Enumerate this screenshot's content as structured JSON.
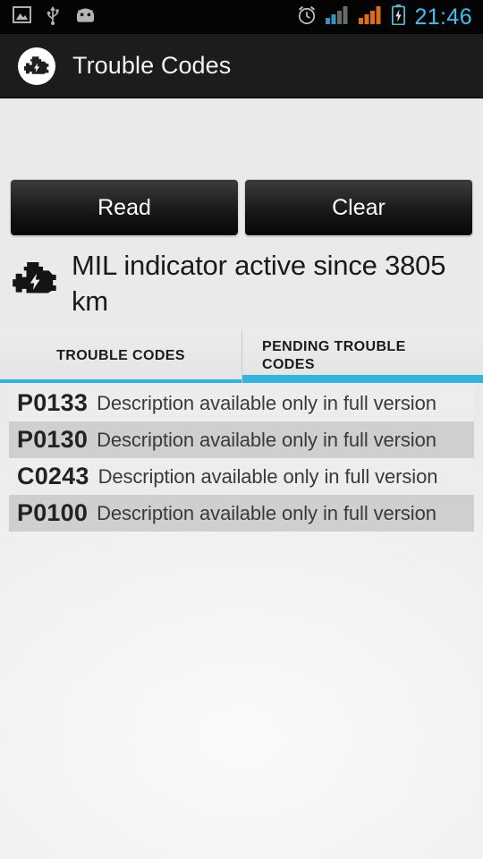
{
  "status_bar": {
    "left_icons": [
      {
        "name": "gallery-image-icon",
        "glyph": "image"
      },
      {
        "name": "usb-icon",
        "glyph": "usb"
      },
      {
        "name": "android-robot-icon",
        "glyph": "android"
      }
    ],
    "right_icons": [
      {
        "name": "alarm-clock-icon",
        "glyph": "alarm"
      },
      {
        "name": "signal-bars-sim1-icon",
        "glyph": "signal",
        "color": "#3a9fd0"
      },
      {
        "name": "signal-bars-sim2-icon",
        "glyph": "signal",
        "color": "#f07818"
      },
      {
        "name": "battery-charging-icon",
        "glyph": "battery",
        "color": "#5fc5e8"
      }
    ],
    "clock": "21:46"
  },
  "action_bar": {
    "logo_icon": "check-engine-icon",
    "title": "Trouble Codes"
  },
  "toolbar": {
    "read_label": "Read",
    "clear_label": "Clear"
  },
  "mil_banner": {
    "icon": "check-engine-icon",
    "text": "MIL indicator active since 3805 km"
  },
  "tabs": {
    "accent_color": "#35b2e0",
    "items": [
      {
        "id": "trouble-codes",
        "label": "TROUBLE CODES",
        "selected": true
      },
      {
        "id": "pending-trouble-codes",
        "label": "PENDING TROUBLE CODES",
        "selected": false
      }
    ]
  },
  "code_list": {
    "rows": [
      {
        "code": "P0133",
        "description": "Description available only in full version"
      },
      {
        "code": "P0130",
        "description": "Description available only in full version"
      },
      {
        "code": "C0243",
        "description": "Description available only in full version"
      },
      {
        "code": "P0100",
        "description": "Description available only in full version"
      }
    ]
  }
}
